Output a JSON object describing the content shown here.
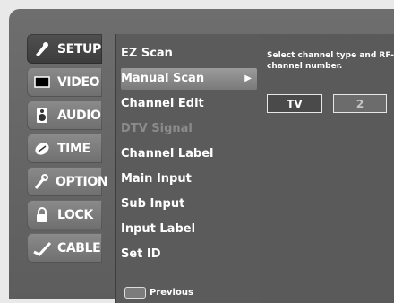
{
  "tabs": [
    {
      "label": "SETUP",
      "icon": "setup-icon",
      "active": true
    },
    {
      "label": "VIDEO",
      "icon": "video-icon",
      "active": false
    },
    {
      "label": "AUDIO",
      "icon": "audio-icon",
      "active": false
    },
    {
      "label": "TIME",
      "icon": "time-icon",
      "active": false
    },
    {
      "label": "OPTION",
      "icon": "option-icon",
      "active": false
    },
    {
      "label": "LOCK",
      "icon": "lock-icon",
      "active": false
    },
    {
      "label": "CABLE",
      "icon": "cable-icon",
      "active": false
    }
  ],
  "menu": {
    "items": [
      {
        "label": "EZ Scan",
        "state": "normal"
      },
      {
        "label": "Manual Scan",
        "state": "selected"
      },
      {
        "label": "Channel Edit",
        "state": "normal"
      },
      {
        "label": "DTV Signal",
        "state": "disabled"
      },
      {
        "label": "Channel Label",
        "state": "normal"
      },
      {
        "label": "Main Input",
        "state": "normal"
      },
      {
        "label": "Sub Input",
        "state": "normal"
      },
      {
        "label": "Input Label",
        "state": "normal"
      },
      {
        "label": "Set ID",
        "state": "normal"
      }
    ],
    "footer_label": "Previous"
  },
  "panel": {
    "instruction": "Select channel type and RF-channel number.",
    "channel_type": "TV",
    "channel_number": "2"
  },
  "colors": {
    "panel": "#5b5b5b",
    "tab": "#7b7b7b",
    "active_tab": "#454545",
    "selected_item": "#8c8c8c"
  }
}
